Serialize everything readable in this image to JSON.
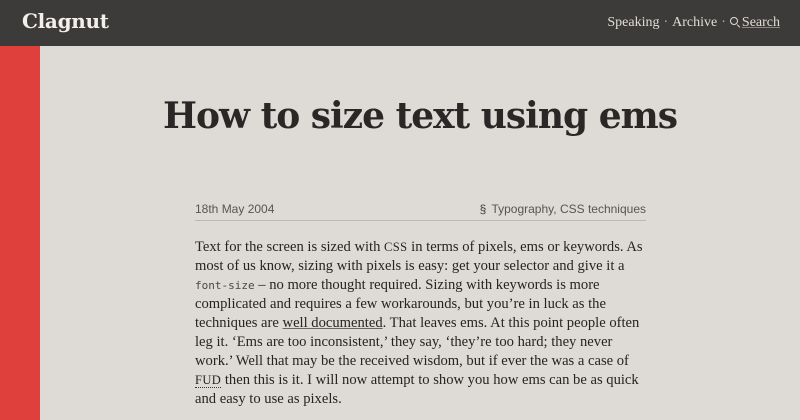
{
  "site": {
    "name": "Clagnut"
  },
  "nav": {
    "items": [
      "Speaking",
      "Archive"
    ],
    "separator": "·",
    "search_label": "Search"
  },
  "colors": {
    "topbar": "#3d3b39",
    "accent_bar": "#df403b",
    "background": "#dedbd6"
  },
  "icons": {
    "search": "search-icon",
    "section": "section-sign-icon"
  },
  "article": {
    "title": "How to size text using ems",
    "date": "18th May 2004",
    "section_symbol": "§",
    "categories": [
      "Typography",
      "CSS techniques"
    ],
    "category_separator": ", ",
    "body": {
      "p1": "Text for the screen is sized with ",
      "css_abbr": "css",
      "p2": " in terms of pixels, ems or keywords. As most of us know, sizing with pixels is easy: get your selector and give it a ",
      "code": "font-size",
      "p3": " – no more thought required. Sizing with keywords is more complicated and requires a few workarounds, but you’re in luck as the techniques are ",
      "link": "well documented",
      "p4": ". That leaves ems. At this point people often leg it. ‘Ems are too inconsistent,’ they say, ‘they’re too hard; they never work.’ Well that may be the received wisdom, but if ever the was a case of ",
      "fud": "fud",
      "p5": " then this is it. I will now attempt to show you how ems can be as quick and easy to use as pixels."
    }
  }
}
